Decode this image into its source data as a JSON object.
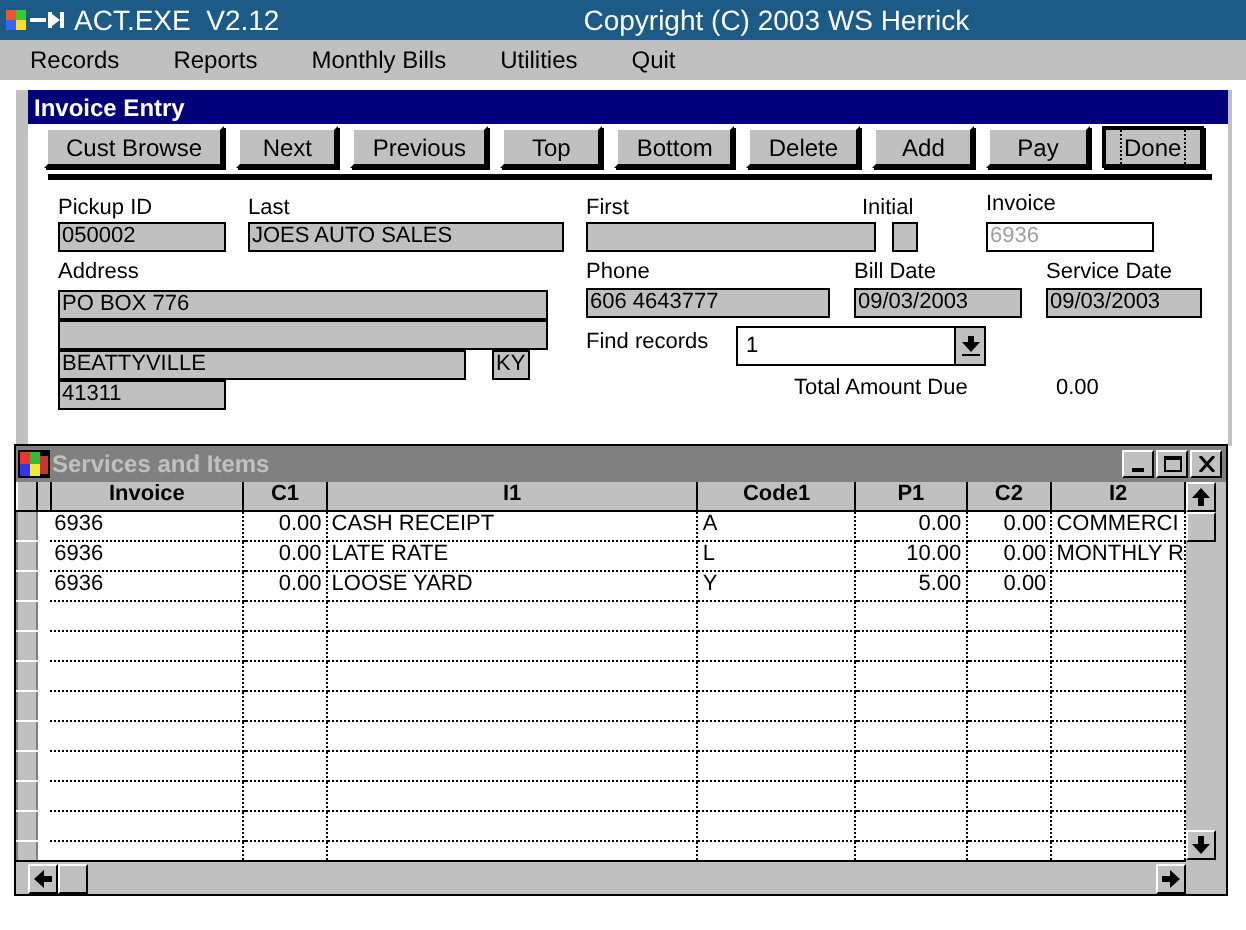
{
  "window": {
    "title": "ACT.EXE  V2.12",
    "copyright": "Copyright (C) 2003 WS Herrick"
  },
  "menu": [
    "Records",
    "Reports",
    "Monthly Bills",
    "Utilities",
    "Quit"
  ],
  "invoice_entry": {
    "title": "Invoice Entry",
    "buttons": [
      {
        "label": "Cust Browse",
        "focused": false
      },
      {
        "label": "Next",
        "focused": false
      },
      {
        "label": "Previous",
        "focused": false
      },
      {
        "label": "Top",
        "focused": false
      },
      {
        "label": "Bottom",
        "focused": false
      },
      {
        "label": "Delete",
        "focused": false
      },
      {
        "label": "Add",
        "focused": false
      },
      {
        "label": "Pay",
        "focused": false
      },
      {
        "label": "Done",
        "focused": true
      }
    ],
    "pickup_id": {
      "label": "Pickup ID",
      "value": "050002"
    },
    "last": {
      "label": "Last",
      "value": "JOES AUTO SALES"
    },
    "first": {
      "label": "First"
    },
    "initial": {
      "label": "Initial"
    },
    "invoice": {
      "label": "Invoice",
      "value": "6936",
      "disabled": true
    },
    "address": {
      "label": "Address",
      "line_1": "PO BOX 776",
      "city": "BEATTYVILLE",
      "state": "KY",
      "zip": "41311"
    },
    "phone": {
      "label": "Phone",
      "value": "606 4643777"
    },
    "bill_date": {
      "label": "Bill Date",
      "value": "09/03/2003"
    },
    "service_date": {
      "label": "Service Date",
      "value": "09/03/2003"
    },
    "find_records": {
      "label": "Find records",
      "value": "1"
    },
    "total_amount_due": {
      "label": "Total Amount Due",
      "value": "0.00"
    }
  },
  "services": {
    "title": "Services and Items",
    "columns": [
      {
        "label": "Invoice",
        "kind": "text"
      },
      {
        "label": "C1",
        "kind": "number"
      },
      {
        "label": "I1",
        "kind": "text"
      },
      {
        "label": "Code1",
        "kind": "text"
      },
      {
        "label": "P1",
        "kind": "number"
      },
      {
        "label": "C2",
        "kind": "number"
      },
      {
        "label": "I2",
        "kind": "text"
      }
    ],
    "rows": [
      [
        "6936",
        "0.00",
        "CASH RECEIPT",
        "A",
        "0.00",
        "0.00",
        "COMMERCI"
      ],
      [
        "6936",
        "0.00",
        "LATE RATE",
        "L",
        "10.00",
        "0.00",
        "MONTHLY R"
      ],
      [
        "6936",
        "0.00",
        "LOOSE YARD",
        "Y",
        "5.00",
        "0.00"
      ]
    ]
  }
}
